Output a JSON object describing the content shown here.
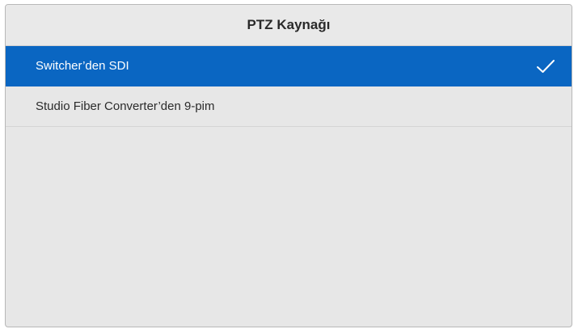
{
  "dialog": {
    "title": "PTZ Kaynağı"
  },
  "options": {
    "items": [
      {
        "label": "Switcher’den SDI",
        "selected": true
      },
      {
        "label": "Studio Fiber Converter’den 9-pim",
        "selected": false
      }
    ]
  },
  "colors": {
    "selected_background": "#0a66c2",
    "panel_background": "#e7e7e7",
    "text": "#2b2b2b"
  },
  "icons": {
    "selected_indicator": "check-icon"
  }
}
